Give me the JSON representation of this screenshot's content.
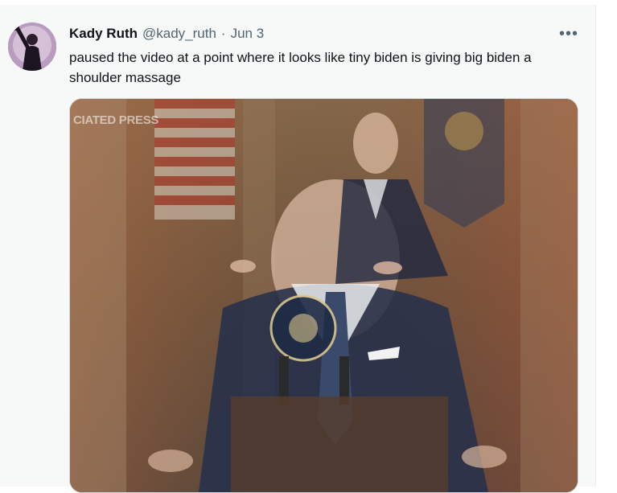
{
  "tweet": {
    "display_name": "Kady Ruth",
    "handle": "@kady_ruth",
    "separator": "·",
    "date": "Jun 3",
    "more_icon": "more-horizontal-icon",
    "text": "paused the video at a point where it looks like tiny biden is giving big biden a shoulder massage",
    "media": {
      "watermark": "CIATED PRESS"
    }
  }
}
